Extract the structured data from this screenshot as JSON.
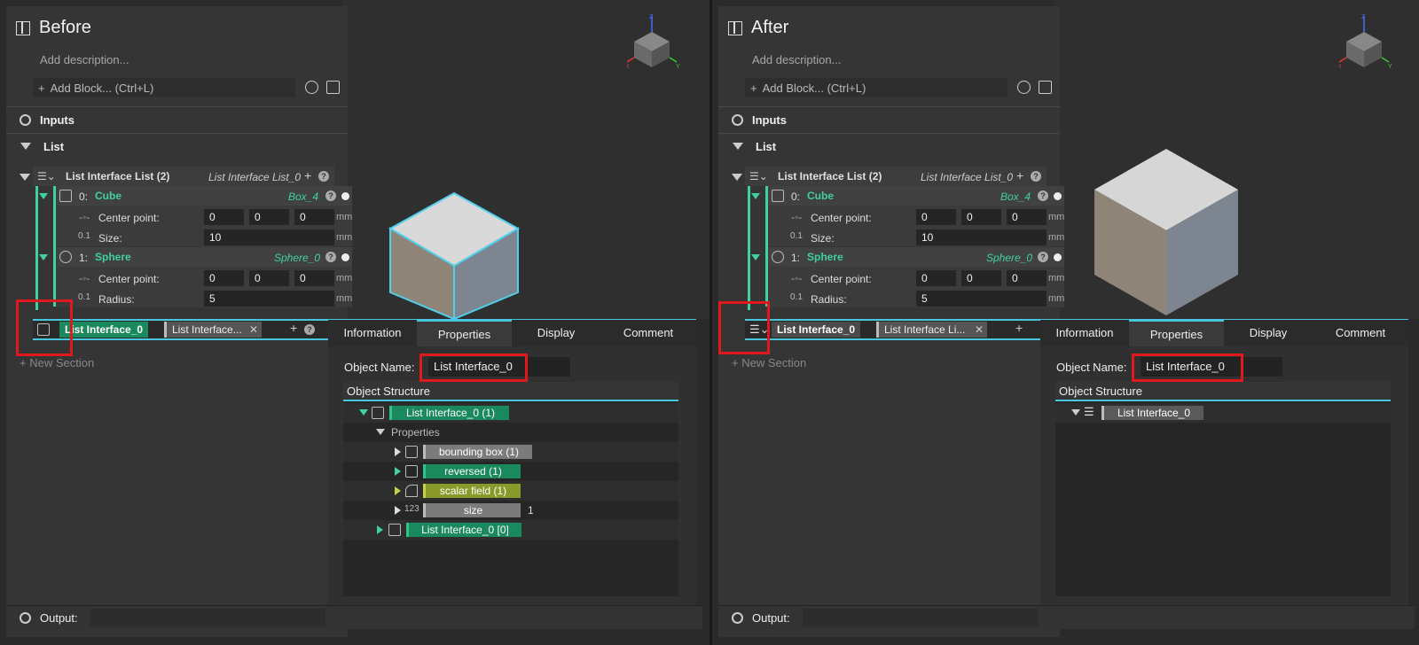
{
  "colors": {
    "accent": "#48c6dd",
    "green": "#3fd19f",
    "highlight": "#e0191f",
    "node_green": "#1a8a5e",
    "node_gray": "#7b7b7b",
    "node_olive": "#8a9a2a"
  },
  "before": {
    "title": "Before",
    "description": "Add description...",
    "add_block": "Add Block... (Ctrl+L)",
    "inputs_label": "Inputs",
    "list_label": "List",
    "list_iface": {
      "label": "List Interface List (2)",
      "name": "List Interface List_0"
    },
    "items": [
      {
        "index": "0:",
        "type": "Cube",
        "name": "Box_4",
        "rows": [
          {
            "label": "Center point:",
            "values": [
              "0",
              "0",
              "0"
            ],
            "unit": "mm"
          },
          {
            "label": "Size:",
            "values": [
              "10"
            ],
            "unit": "mm"
          }
        ]
      },
      {
        "index": "1:",
        "type": "Sphere",
        "name": "Sphere_0",
        "rows": [
          {
            "label": "Center point:",
            "values": [
              "0",
              "0",
              "0"
            ],
            "unit": "mm"
          },
          {
            "label": "Radius:",
            "values": [
              "5"
            ],
            "unit": "mm"
          }
        ]
      }
    ],
    "iface_row": {
      "label": "List Interface_0",
      "chip": "List Interface..."
    },
    "new_section": "New Section",
    "output_label": "Output:",
    "tabs": [
      "Information",
      "Properties",
      "Display",
      "Comment"
    ],
    "object_name_label": "Object Name:",
    "object_name": "List Interface_0",
    "object_structure": "Object Structure",
    "tree": {
      "root": "List Interface_0 (1)",
      "properties": "Properties",
      "bounding_box": "bounding box (1)",
      "reversed": "reversed (1)",
      "scalar_field": "scalar field (1)",
      "size": "size",
      "size_value": "1",
      "child": "List Interface_0 [0]"
    }
  },
  "after": {
    "title": "After",
    "description": "Add description...",
    "add_block": "Add Block... (Ctrl+L)",
    "inputs_label": "Inputs",
    "list_label": "List",
    "list_iface": {
      "label": "List Interface List (2)",
      "name": "List Interface List_0"
    },
    "items": [
      {
        "index": "0:",
        "type": "Cube",
        "name": "Box_4",
        "rows": [
          {
            "label": "Center point:",
            "values": [
              "0",
              "0",
              "0"
            ],
            "unit": "mm"
          },
          {
            "label": "Size:",
            "values": [
              "10"
            ],
            "unit": "mm"
          }
        ]
      },
      {
        "index": "1:",
        "type": "Sphere",
        "name": "Sphere_0",
        "rows": [
          {
            "label": "Center point:",
            "values": [
              "0",
              "0",
              "0"
            ],
            "unit": "mm"
          },
          {
            "label": "Radius:",
            "values": [
              "5"
            ],
            "unit": "mm"
          }
        ]
      }
    ],
    "iface_row": {
      "label": "List Interface_0",
      "chip": "List Interface Li..."
    },
    "new_section": "New Section",
    "output_label": "Output:",
    "tabs": [
      "Information",
      "Properties",
      "Display",
      "Comment"
    ],
    "object_name_label": "Object Name:",
    "object_name": "List Interface_0",
    "object_structure": "Object Structure",
    "tree": {
      "root": "List Interface_0"
    }
  },
  "gizmo": {
    "x": "X",
    "y": "Y",
    "z": "Z"
  }
}
